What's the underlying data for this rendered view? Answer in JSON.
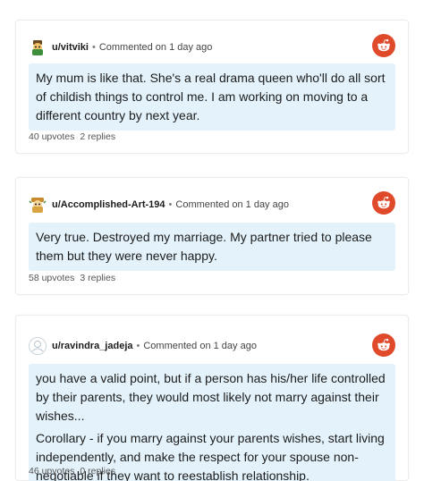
{
  "comments": [
    {
      "username": "u/vitviki",
      "separator": "•",
      "meta": "Commented on 1 day ago",
      "paragraphs": [
        "My mum is like that. She's a real drama queen who'll do all sort of childish things to control me. I am working on moving to a different country by next year."
      ],
      "upvotes": "40 upvotes",
      "replies": "2 replies"
    },
    {
      "username": "u/Accomplished-Art-194",
      "separator": "•",
      "meta": "Commented on 1 day ago",
      "paragraphs": [
        "Very true. Destroyed my marriage. My partner tried to please them but they were never happy."
      ],
      "upvotes": "58 upvotes",
      "replies": "3 replies"
    },
    {
      "username": "u/ravindra_jadeja",
      "separator": "•",
      "meta": "Commented on 1 day ago",
      "paragraphs": [
        "you have a valid point, but if a person has his/her life controlled by their parents, they would most likely not marry against their wishes...",
        "Corollary - if you marry against your parents wishes, start living independently, and make the respect for your spouse non-negotiable if they want to reestablish relationship."
      ],
      "upvotes": "46 upvotes",
      "replies": "0 replies"
    }
  ],
  "icons": {
    "brand": "reddit-icon",
    "avatars": [
      "snoo-avatar-icon",
      "snoo-avatar-icon",
      "default-avatar-icon"
    ]
  },
  "colors": {
    "bubble": "#e4f3fb",
    "reddit": "#e04a2a"
  }
}
